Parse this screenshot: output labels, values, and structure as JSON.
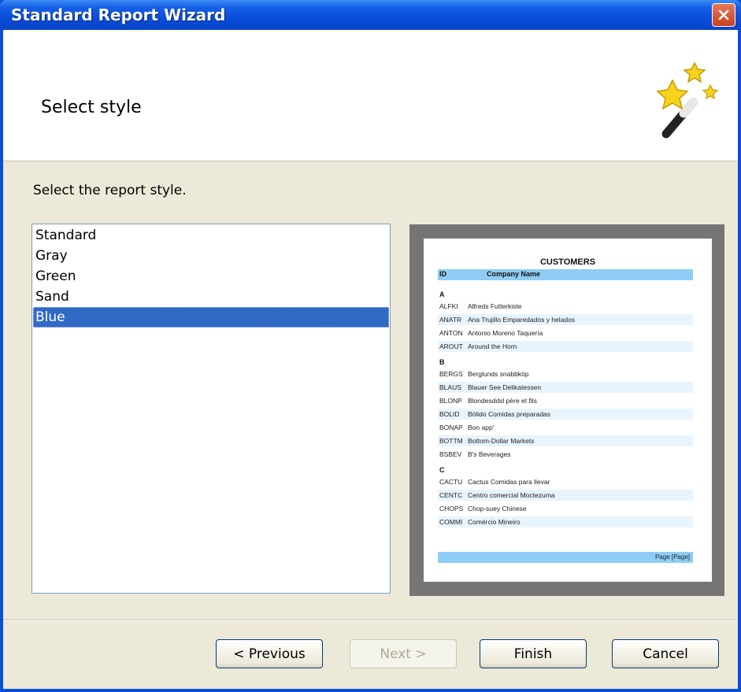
{
  "window": {
    "title": "Standard Report Wizard"
  },
  "header": {
    "title": "Select style"
  },
  "instruction": "Select the report style.",
  "styles": {
    "items": [
      "Standard",
      "Gray",
      "Green",
      "Sand",
      "Blue"
    ],
    "selected": "Blue"
  },
  "preview": {
    "title": "CUSTOMERS",
    "col_id": "ID",
    "col_name": "Company Name",
    "groups": [
      {
        "letter": "A",
        "rows": [
          [
            "ALFKI",
            "Alfreds Futterkiste"
          ],
          [
            "ANATR",
            "Ana Trujillo Emparedados y helados"
          ],
          [
            "ANTON",
            "Antonio Moreno Taquería"
          ],
          [
            "AROUT",
            "Around the Horn"
          ]
        ]
      },
      {
        "letter": "B",
        "rows": [
          [
            "BERGS",
            "Berglunds snabbköp"
          ],
          [
            "BLAUS",
            "Blauer See Delikatessen"
          ],
          [
            "BLONP",
            "Blondesddsl père et fils"
          ],
          [
            "BOLID",
            "Bólido Comidas preparadas"
          ],
          [
            "BONAP",
            "Bon app'"
          ],
          [
            "BOTTM",
            "Bottom-Dollar Markets"
          ],
          [
            "BSBEV",
            "B's Beverages"
          ]
        ]
      },
      {
        "letter": "C",
        "rows": [
          [
            "CACTU",
            "Cactus Comidas para llevar"
          ],
          [
            "CENTC",
            "Centro comercial Moctezuma"
          ],
          [
            "CHOPS",
            "Chop-suey Chinese"
          ],
          [
            "COMMI",
            "Comércio Mineiro"
          ]
        ]
      }
    ],
    "footer": "Page [Page]"
  },
  "buttons": {
    "previous": "< Previous",
    "next": "Next >",
    "finish": "Finish",
    "cancel": "Cancel"
  },
  "icons": {
    "close": "close-icon",
    "wand": "magic-wand-icon"
  }
}
